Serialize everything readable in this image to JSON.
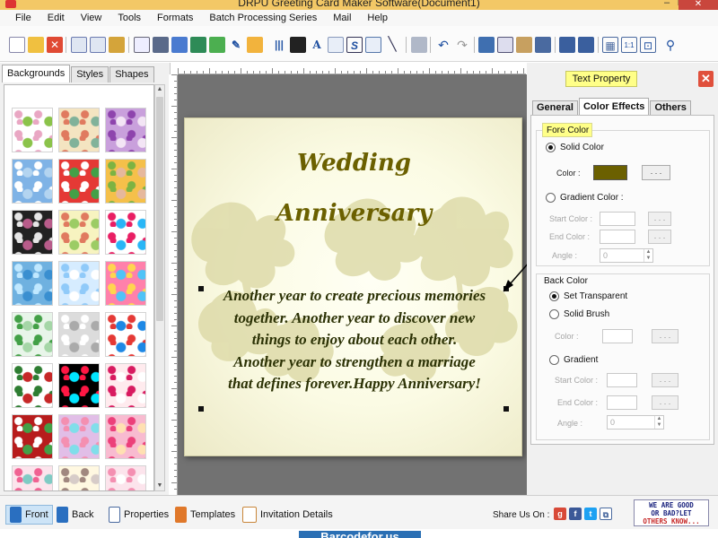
{
  "window": {
    "title": "DRPU Greeting Card Maker Software(Document1)"
  },
  "menu": [
    "File",
    "Edit",
    "View",
    "Tools",
    "Formats",
    "Batch Processing Series",
    "Mail",
    "Help"
  ],
  "left_panel": {
    "tabs": [
      "Backgrounds",
      "Styles",
      "Shapes"
    ],
    "active_tab": "Backgrounds"
  },
  "card": {
    "heading_line1": "Wedding",
    "heading_line2": "Anniversary",
    "message_lines": [
      "Another year to create precious memories",
      "together. Another year to discover new",
      "things to enjoy about each other.",
      "Another year to strengthen a marriage",
      "that defines forever.Happy Anniversary!"
    ],
    "text_color": "#6b6000"
  },
  "properties": {
    "header": "Text Property",
    "close_symbol": "✕",
    "tabs": [
      "General",
      "Color Effects",
      "Others"
    ],
    "active_tab": "Color Effects",
    "fore_color": {
      "title": "Fore Color",
      "solid_color_label": "Solid Color",
      "solid_selected": true,
      "color_label": "Color :",
      "color_value": "#6b6000",
      "browse_label": ". . .",
      "gradient_color_label": "Gradient Color :",
      "start_color_label": "Start Color :",
      "end_color_label": "End Color :",
      "angle_label": "Angle :",
      "angle_value": "0"
    },
    "back_color": {
      "title": "Back Color",
      "set_transparent_label": "Set Transparent",
      "set_transparent_selected": true,
      "solid_brush_label": "Solid Brush",
      "color_label": "Color :",
      "gradient_label": "Gradient",
      "start_color_label": "Start Color :",
      "end_color_label": "End Color :",
      "angle_label": "Angle :",
      "angle_value": "0"
    }
  },
  "status_bar": {
    "buttons": [
      "Front",
      "Back",
      "Properties",
      "Templates",
      "Invitation Details"
    ],
    "share_label": "Share Us On :",
    "feedback_line1": "WE ARE GOOD",
    "feedback_line2": "OR BAD?LET",
    "feedback_line3": "OTHERS KNOW..."
  },
  "watermark": "Barcodefor.us"
}
